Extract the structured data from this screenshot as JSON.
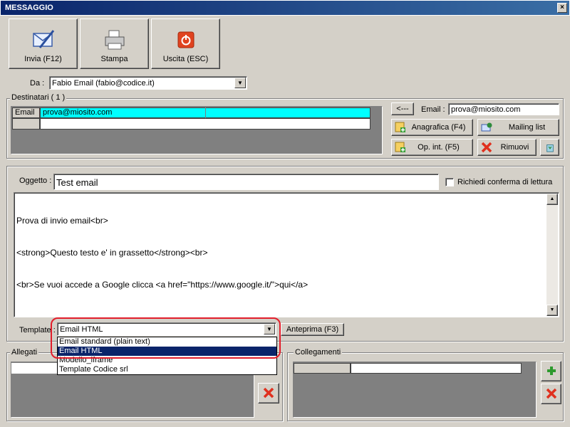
{
  "window": {
    "title": "MESSAGGIO",
    "close_glyph": "×"
  },
  "toolbar": [
    {
      "label": "Invia (F12)",
      "icon": "send-mail-icon"
    },
    {
      "label": "Stampa",
      "icon": "printer-icon"
    },
    {
      "label": "Uscita (ESC)",
      "icon": "power-icon"
    }
  ],
  "from": {
    "label": "Da :",
    "value": "Fabio Email (fabio@codice.it)"
  },
  "recipients": {
    "group_label": "Destinatari ( 1 )",
    "rows": [
      {
        "type": "Email",
        "address": "prova@miosito.com"
      },
      {
        "type": "",
        "address": ""
      }
    ],
    "back_button": "<---",
    "email_label": "Email :",
    "email_value": "prova@miosito.com",
    "anagrafica_button": "Anagrafica (F4)",
    "mailing_button": "Mailing list",
    "opint_button": "Op. int. (F5)",
    "remove_button": "Rimuovi"
  },
  "message": {
    "subject_label": "Oggetto :",
    "subject_value": "Test email",
    "read_receipt_label": "Richiedi conferma di lettura",
    "body_lines": [
      "Prova di invio email<br>",
      "<strong>Questo testo e' in grassetto</strong><br>",
      "<br>Se vuoi accede a Google clicca <a href=\"https://www.google.it/\">qui</a>"
    ]
  },
  "template": {
    "label": "Template :",
    "selected": "Email HTML",
    "options": [
      "Email standard (plain text)",
      "Email HTML",
      "Modello_iframe",
      "Template Codice srl"
    ],
    "preview_button": "Anteprima (F3)"
  },
  "attachments": {
    "group_label": "Allegati"
  },
  "links": {
    "group_label": "Collegamenti"
  },
  "colors": {
    "titlebar": "#0a246a",
    "selection": "#00ffff",
    "highlight": "#e21d2a",
    "face": "#d4d0c8"
  }
}
